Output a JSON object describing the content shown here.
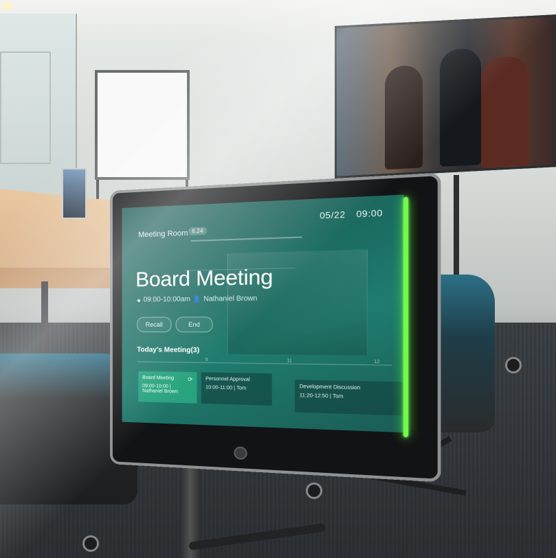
{
  "photo": {
    "description_colors": {
      "led": "#6dfc47",
      "screen": "#1b6b61",
      "accent_card": "#27a37d"
    }
  },
  "panel": {
    "room_label": "Meeting Room",
    "room_badge": "6.24",
    "date": "05/22",
    "time": "09:00",
    "meeting_title": "Board Meeting",
    "meeting_time": "09:00-10:00am",
    "host": "Nathaniel Brown",
    "buttons": {
      "recall": "Recall",
      "end": "End"
    },
    "icons": {
      "clock": "clock-icon",
      "person": "person-icon",
      "sync": "sync-icon",
      "home": "home-button-icon"
    },
    "schedule_title": "Today's Meeting(3)",
    "ticks": [
      "9",
      "11",
      "12"
    ],
    "meetings": [
      {
        "name": "Board Meeting",
        "time": "09:00-10:00",
        "host": "Nathaniel Brown"
      },
      {
        "name": "Personnel Approval",
        "time": "10:00-11:00",
        "host": "Tom"
      },
      {
        "name": "Development Discussion",
        "time": "11:20-12:50",
        "host": "Tom"
      }
    ]
  }
}
